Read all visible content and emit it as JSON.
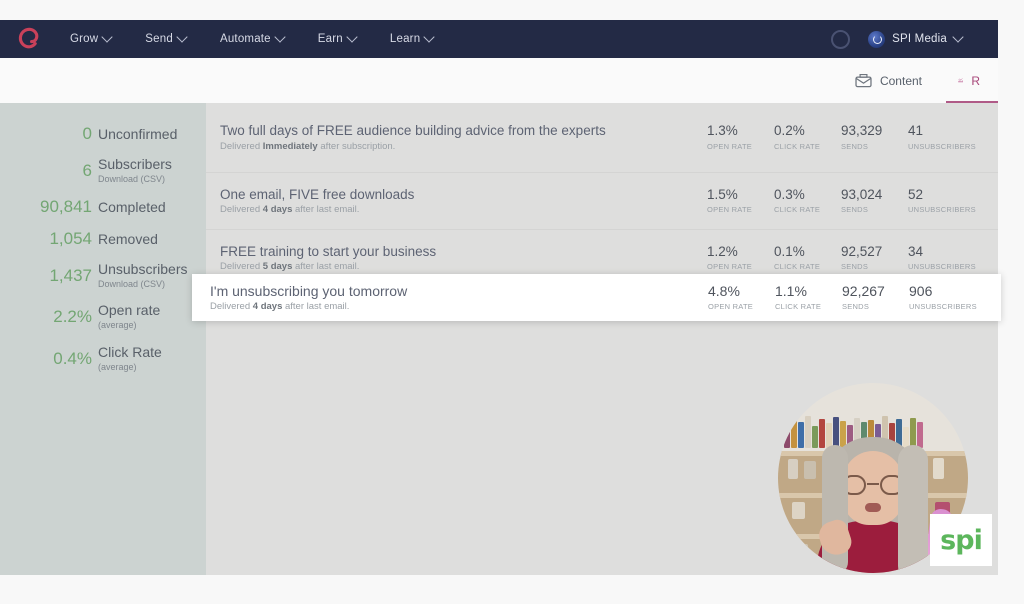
{
  "nav": {
    "logo_icon": "convertkit-logo-icon",
    "items": [
      {
        "label": "Grow"
      },
      {
        "label": "Send"
      },
      {
        "label": "Automate"
      },
      {
        "label": "Earn"
      },
      {
        "label": "Learn"
      }
    ],
    "ring_icon": "status-ring-icon",
    "account": {
      "name": "SPI Media",
      "avatar_icon": "account-avatar-icon",
      "caret_icon": "chevron-down-icon"
    }
  },
  "tabbar": {
    "tabs": [
      {
        "label": "Content",
        "icon": "mail-icon",
        "active": false
      },
      {
        "label": "R",
        "icon": "bar-chart-icon",
        "active": true
      }
    ]
  },
  "sidebar": {
    "stats": [
      {
        "value": "0",
        "label": "Unconfirmed",
        "sub": ""
      },
      {
        "value": "6",
        "label": "Subscribers",
        "sub": "Download (CSV)"
      },
      {
        "value": "90,841",
        "label": "Completed",
        "sub": ""
      },
      {
        "value": "1,054",
        "label": "Removed",
        "sub": ""
      },
      {
        "value": "1,437",
        "label": "Unsubscribers",
        "sub": "Download (CSV)"
      },
      {
        "value": "2.2%",
        "label": "Open rate",
        "sub": "(average)"
      },
      {
        "value": "0.4%",
        "label": "Click Rate",
        "sub": "(average)"
      }
    ]
  },
  "list": {
    "metric_labels": {
      "open_rate": "OPEN RATE",
      "click_rate": "CLICK RATE",
      "sends": "SENDS",
      "unsubscribers": "UNSUBSCRIBERS"
    },
    "rows": [
      {
        "title": "Two full days of FREE audience building advice from the experts",
        "delivery_prefix": "Delivered ",
        "delivery_bold": "Immediately",
        "delivery_suffix": " after subscription.",
        "open_rate": "1.3%",
        "click_rate": "0.2%",
        "sends": "93,329",
        "unsubscribers": "41"
      },
      {
        "title": "One email, FIVE free downloads",
        "delivery_prefix": "Delivered ",
        "delivery_bold": "4 days",
        "delivery_suffix": " after last email.",
        "open_rate": "1.5%",
        "click_rate": "0.3%",
        "sends": "93,024",
        "unsubscribers": "52"
      },
      {
        "title": "FREE training to start your business",
        "delivery_prefix": "Delivered ",
        "delivery_bold": "5 days",
        "delivery_suffix": " after last email.",
        "open_rate": "1.2%",
        "click_rate": "0.1%",
        "sends": "92,527",
        "unsubscribers": "34"
      }
    ],
    "highlighted_row": {
      "title": "I'm unsubscribing you tomorrow",
      "delivery_prefix": "Delivered ",
      "delivery_bold": "4 days",
      "delivery_suffix": " after last email.",
      "open_rate": "4.8%",
      "click_rate": "1.1%",
      "sends": "92,267",
      "unsubscribers": "906"
    }
  },
  "overlay": {
    "webcam_label": "presenter-webcam",
    "logo_text": "spi",
    "logo_color": "#5cb65c"
  }
}
